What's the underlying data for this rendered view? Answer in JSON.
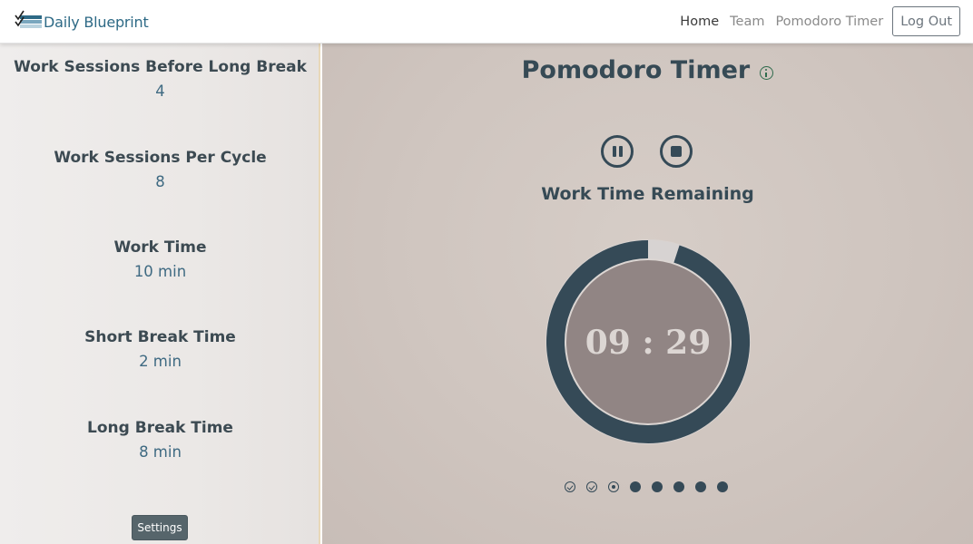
{
  "brand": {
    "name": "Daily Blueprint",
    "logo_icon": "checklist-logo-icon"
  },
  "nav": {
    "links": [
      {
        "label": "Home",
        "active": true
      },
      {
        "label": "Team",
        "active": false
      },
      {
        "label": "Pomodoro Timer",
        "active": false
      }
    ],
    "logout_label": "Log Out"
  },
  "sidebar": {
    "settings": [
      {
        "label": "Work Sessions Before Long Break",
        "value": "4"
      },
      {
        "label": "Work Sessions Per Cycle",
        "value": "8"
      },
      {
        "label": "Work Time",
        "value": "10 min"
      },
      {
        "label": "Short Break Time",
        "value": "2 min"
      },
      {
        "label": "Long Break Time",
        "value": "8 min"
      }
    ],
    "settings_button_label": "Settings"
  },
  "main": {
    "title": "Pomodoro Timer",
    "info_icon": "info-icon",
    "controls": {
      "pause_icon": "pause-icon",
      "stop_icon": "stop-icon"
    },
    "status_label": "Work Time Remaining",
    "timer": {
      "display": "09 : 29",
      "progress_fraction": 0.05,
      "work_time_min": 10
    },
    "sessions": [
      "done",
      "done",
      "current",
      "pending",
      "pending",
      "pending",
      "pending",
      "pending"
    ]
  },
  "colors": {
    "accent": "#354a57",
    "brand": "#2e6a86",
    "timer_face": "#918584",
    "timer_ring": "#354a57",
    "timer_ring_track": "#d7d3d2",
    "timer_text": "#dcd6d3",
    "settings_button": "#56656b"
  }
}
